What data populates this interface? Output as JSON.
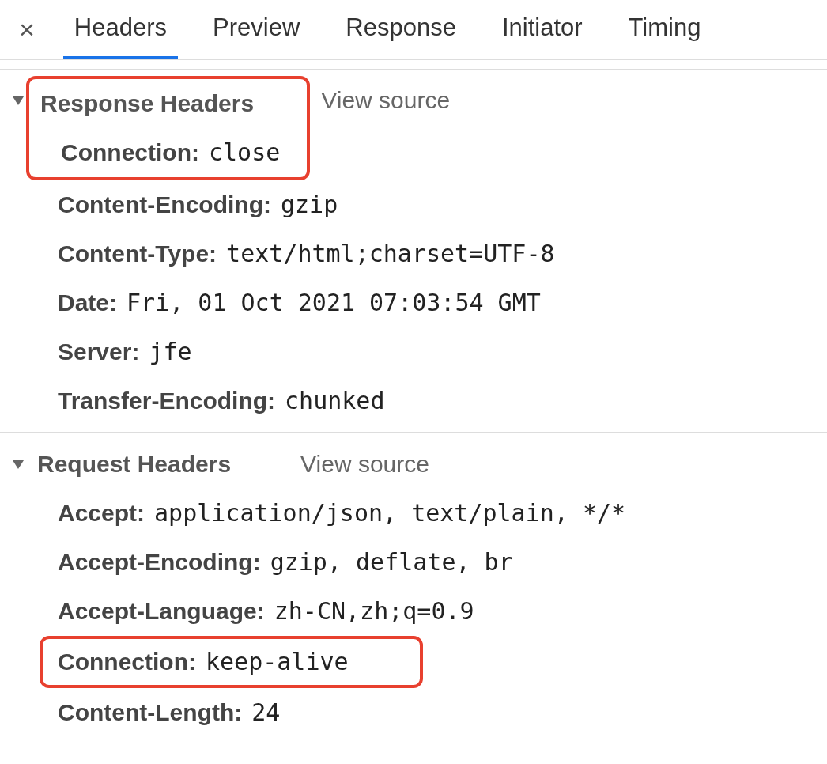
{
  "tabs": {
    "close_label": "×",
    "items": [
      {
        "label": "Headers",
        "selected": true
      },
      {
        "label": "Preview",
        "selected": false
      },
      {
        "label": "Response",
        "selected": false
      },
      {
        "label": "Initiator",
        "selected": false
      },
      {
        "label": "Timing",
        "selected": false
      }
    ]
  },
  "sections": [
    {
      "title": "Response Headers",
      "expanded": true,
      "title_highlighted": true,
      "view_source": "View source",
      "headers": [
        {
          "name": "Connection:",
          "value": "close",
          "highlighted": true
        },
        {
          "name": "Content-Encoding:",
          "value": "gzip",
          "highlighted": false
        },
        {
          "name": "Content-Type:",
          "value": "text/html;charset=UTF-8",
          "highlighted": false
        },
        {
          "name": "Date:",
          "value": "Fri, 01 Oct 2021 07:03:54 GMT",
          "highlighted": false
        },
        {
          "name": "Server:",
          "value": "jfe",
          "highlighted": false
        },
        {
          "name": "Transfer-Encoding:",
          "value": "chunked",
          "highlighted": false
        }
      ]
    },
    {
      "title": "Request Headers",
      "expanded": true,
      "title_highlighted": false,
      "view_source": "View source",
      "headers": [
        {
          "name": "Accept:",
          "value": "application/json, text/plain, */*",
          "highlighted": false
        },
        {
          "name": "Accept-Encoding:",
          "value": "gzip, deflate, br",
          "highlighted": false
        },
        {
          "name": "Accept-Language:",
          "value": "zh-CN,zh;q=0.9",
          "highlighted": false
        },
        {
          "name": "Connection:",
          "value": "keep-alive",
          "highlighted": true
        },
        {
          "name": "Content-Length:",
          "value": "24",
          "highlighted": false
        }
      ]
    }
  ]
}
